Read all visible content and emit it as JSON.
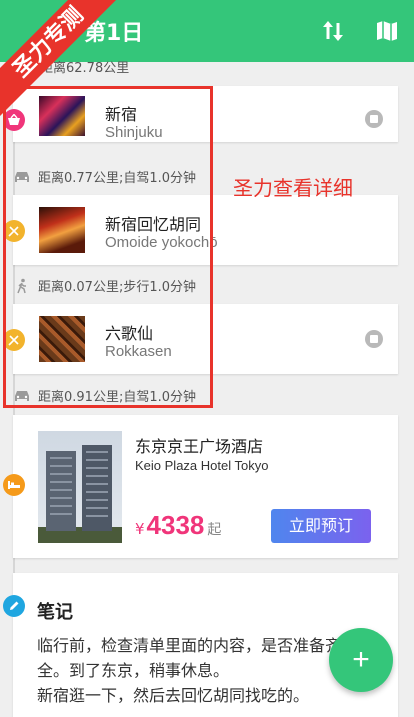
{
  "header": {
    "title": "第1日",
    "sort_icon": "sort-arrows-icon",
    "map_icon": "map-icon"
  },
  "ribbon": {
    "text": "圣力专测"
  },
  "annotation": {
    "text": "圣力查看详细"
  },
  "top_distance": "距离62.78公里",
  "places": [
    {
      "name": "新宿",
      "subtitle": "Shinjuku",
      "category_icon": "shopping-basket-icon",
      "category_color": "#f0357a",
      "has_marker": true
    },
    {
      "name": "新宿回忆胡同",
      "subtitle": "Omoide yokochō",
      "category_icon": "fork-knife-icon",
      "category_color": "#f2b32c",
      "has_marker": false
    },
    {
      "name": "六歌仙",
      "subtitle": "Rokkasen",
      "category_icon": "fork-knife-icon",
      "category_color": "#f2b32c",
      "has_marker": true
    }
  ],
  "distances": [
    {
      "text": "距离0.77公里;自驾1.0分钟",
      "icon": "car-icon"
    },
    {
      "text": "距离0.07公里;步行1.0分钟",
      "icon": "walk-icon"
    },
    {
      "text": "距离0.91公里;自驾1.0分钟",
      "icon": "car-icon"
    }
  ],
  "hotel": {
    "name": "东京京王广场酒店",
    "subtitle": "Keio Plaza Hotel Tokyo",
    "currency": "¥",
    "price": "4338",
    "price_unit": "起",
    "book_label": "立即预订",
    "category_icon": "bed-icon",
    "category_color": "#f59a1a"
  },
  "note": {
    "title": "笔记",
    "lines": [
      "临行前，检查清单里面的内容，是否准备齐",
      "全。到了东京，稍事休息。",
      "新宿逛一下，然后去回忆胡同找吃的。"
    ],
    "category_icon": "pencil-icon",
    "category_color": "#1fa6e0"
  },
  "fab": {
    "label": "+"
  },
  "colors": {
    "primary": "#34c67a",
    "accent_red": "#e8332b",
    "price_pink": "#f0357a"
  }
}
